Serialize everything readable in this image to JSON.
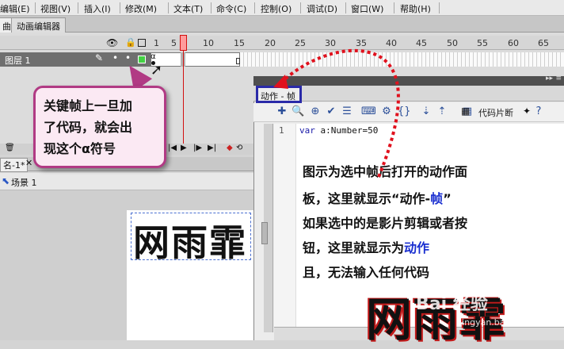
{
  "menu": [
    "编辑(E)",
    "视图(V)",
    "插入(I)",
    "修改(M)",
    "文本(T)",
    "命令(C)",
    "控制(O)",
    "调试(D)",
    "窗口(W)",
    "帮助(H)"
  ],
  "tabs": {
    "timeline": "曲",
    "motion_editor": "动画编辑器"
  },
  "timeline": {
    "ruler": [
      "1",
      "5",
      "10",
      "15",
      "20",
      "25",
      "30",
      "35",
      "40",
      "45",
      "50",
      "55",
      "60",
      "65"
    ],
    "layer_name": "图层 1",
    "keyframe_symbol": "α"
  },
  "callout": {
    "line1": "关键帧上一旦加",
    "line2": "了代码，就会出",
    "line3": "现这个α符号"
  },
  "document": {
    "tab": "名-1*",
    "scene": "场景 1",
    "stage_text": "网雨霏"
  },
  "actions_panel": {
    "tab": "动作 - 帧",
    "code_snippet_label": "代码片断",
    "line_number": "1",
    "code_keyword": "var",
    "code_rest": " a:Number=50"
  },
  "notes": {
    "line1": "图示为选中帧后打开的动作面",
    "line2_a": "板，这里就显示“动作-",
    "line2_b": "帧",
    "line2_c": "”",
    "line3": "如果选中的是影片剪辑或者按",
    "line4_a": "钮，这里就显示为",
    "line4_b": "动作",
    "line5": "且，无法输入任何代码"
  },
  "watermark": {
    "big": "网雨霏",
    "logo": "Bai 经验",
    "url": "jingyan.baidu.com"
  },
  "colors": {
    "accent_red": "#d21010",
    "callout_border": "#b13a84",
    "panel_tab_border": "#2a2aa8",
    "note_blue": "#1a2fd0"
  }
}
